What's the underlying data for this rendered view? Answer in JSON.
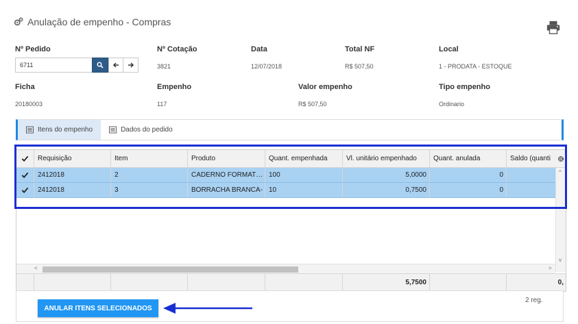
{
  "page": {
    "title": "Anulação de empenho - Compras"
  },
  "icons": {
    "title": "gears-icon",
    "print": "printer-icon",
    "search": "search-icon",
    "prev": "arrow-left-icon",
    "next": "arrow-right-icon",
    "settings": "gear-icon",
    "check": "check-icon",
    "tab": "list-icon"
  },
  "colors": {
    "accent": "#1e88e5",
    "selected_row": "#a9d1f2",
    "search_button": "#2e5c8a",
    "primary_button": "#2196f3",
    "annotation": "#1a2fd1"
  },
  "fields": {
    "pedido": {
      "label": "Nº Pedido",
      "value": "6711"
    },
    "cotacao": {
      "label": "Nº Cotação",
      "value": "3821"
    },
    "data": {
      "label": "Data",
      "value": "12/07/2018"
    },
    "total_nf": {
      "label": "Total NF",
      "value": "R$ 507,50"
    },
    "local": {
      "label": "Local",
      "value": "1 - PRODATA - ESTOQUE"
    },
    "ficha": {
      "label": "Ficha",
      "value": "20180003"
    },
    "empenho": {
      "label": "Empenho",
      "value": "117"
    },
    "valor_empenho": {
      "label": "Valor empenho",
      "value": "R$ 507,50"
    },
    "tipo_empenho": {
      "label": "Tipo empenho",
      "value": "Ordinario"
    }
  },
  "tabs": [
    {
      "label": "Itens do empenho",
      "active": true
    },
    {
      "label": "Dados do pedido",
      "active": false
    }
  ],
  "grid": {
    "columns": [
      "Requisição",
      "Item",
      "Produto",
      "Quant. empenhada",
      "Vl. unitário empenhado",
      "Quant. anulada",
      "Saldo (quanti"
    ],
    "rows": [
      {
        "requisicao": "2412018",
        "item": "2",
        "produto": "CADERNO FORMAT…",
        "quant_empenhada": "100",
        "vl_unitario": "5,0000",
        "quant_anulada": "0",
        "saldo": ""
      },
      {
        "requisicao": "2412018",
        "item": "3",
        "produto": "BORRACHA BRANCA-",
        "quant_empenhada": "10",
        "vl_unitario": "0,7500",
        "quant_anulada": "0",
        "saldo": ""
      }
    ],
    "footer": {
      "vl_unitario_total": "5,7500",
      "saldo_total": "0,"
    }
  },
  "actions": {
    "anular_label": "ANULAR ITENS SELECIONADOS"
  },
  "status": {
    "record_count": "2 reg."
  }
}
